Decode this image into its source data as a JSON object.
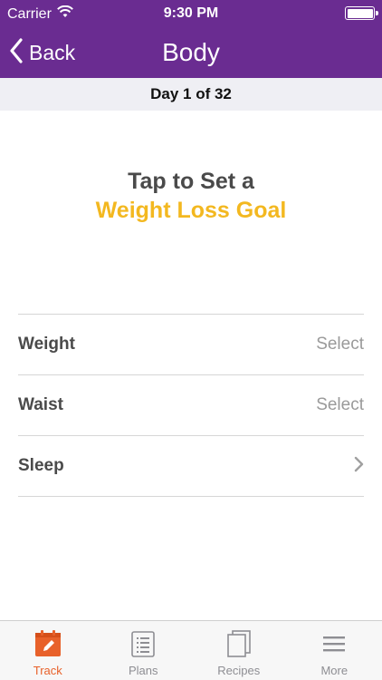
{
  "status_bar": {
    "carrier": "Carrier",
    "time": "9:30 PM"
  },
  "nav": {
    "back_label": "Back",
    "title": "Body"
  },
  "day_bar": {
    "text": "Day 1 of 32"
  },
  "goal": {
    "line1": "Tap to Set a",
    "line2": "Weight Loss Goal"
  },
  "rows": [
    {
      "label": "Weight",
      "value": "Select"
    },
    {
      "label": "Waist",
      "value": "Select"
    },
    {
      "label": "Sleep",
      "value": ""
    }
  ],
  "tabs": [
    {
      "label": "Track",
      "icon": "calendar-edit-icon",
      "active": true
    },
    {
      "label": "Plans",
      "icon": "clipboard-list-icon",
      "active": false
    },
    {
      "label": "Recipes",
      "icon": "recipe-cards-icon",
      "active": false
    },
    {
      "label": "More",
      "icon": "menu-icon",
      "active": false
    }
  ],
  "colors": {
    "header": "#6a2c91",
    "accent_yellow": "#f3b820",
    "active_tab": "#e8612a"
  }
}
